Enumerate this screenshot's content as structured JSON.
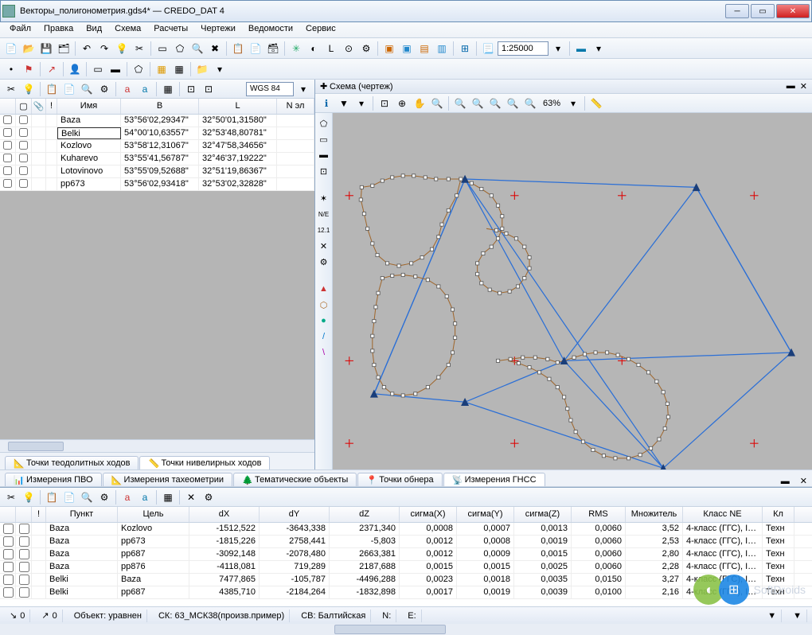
{
  "window": {
    "title": "Векторы_полигонометрия.gds4* — CREDO_DAT 4"
  },
  "menu": [
    "Файл",
    "Правка",
    "Вид",
    "Схема",
    "Расчеты",
    "Чертежи",
    "Ведомости",
    "Сервис"
  ],
  "scale": "1:25000",
  "coord_system": "WGS 84",
  "zoom_pct": "63%",
  "left_panel": {
    "headers": [
      "",
      "",
      "",
      "!",
      "Имя",
      "B",
      "L",
      "N эл"
    ],
    "rows": [
      {
        "name": "Baza",
        "b": "53°56'02,29347\"",
        "l": "32°50'01,31580\""
      },
      {
        "name": "Belki",
        "b": "54°00'10,63557\"",
        "l": "32°53'48,80781\""
      },
      {
        "name": "Kozlovo",
        "b": "53°58'12,31067\"",
        "l": "32°47'58,34656\""
      },
      {
        "name": "Kuharevo",
        "b": "53°55'41,56787\"",
        "l": "32°46'37,19222\""
      },
      {
        "name": "Lotovinovo",
        "b": "53°55'09,52688\"",
        "l": "32°51'19,86367\""
      },
      {
        "name": "pp673",
        "b": "53°56'02,93418\"",
        "l": "32°53'02,32828\""
      }
    ],
    "selected_row": 1
  },
  "left_tabs": [
    "Точки теодолитных ходов",
    "Точки нивелирных ходов"
  ],
  "left_tabs_active": 1,
  "mid_tabs": [
    "Измерения ПВО",
    "Измерения тахеометрии",
    "Тематические объекты",
    "Точки обнера",
    "Измерения ГНСС"
  ],
  "mid_tabs_active": 4,
  "scheme_title": "Схема (чертеж)",
  "bottom_grid": {
    "headers": [
      "",
      "",
      "!",
      "Пункт",
      "Цель",
      "dX",
      "dY",
      "dZ",
      "сигма(X)",
      "сигма(Y)",
      "сигма(Z)",
      "RMS",
      "Множитель",
      "Класс NE",
      "Кл"
    ],
    "widths": [
      20,
      20,
      18,
      90,
      90,
      88,
      88,
      88,
      72,
      72,
      72,
      68,
      72,
      100,
      40
    ],
    "rows": [
      {
        "p": "Baza",
        "t": "Kozlovo",
        "dx": "-1512,522",
        "dy": "-3643,338",
        "dz": "2371,340",
        "sx": "0,0008",
        "sy": "0,0007",
        "sz": "0,0013",
        "rms": "0,0060",
        "m": "3,52",
        "cls": "4-класс (ГГС), I…",
        "k": "Техн"
      },
      {
        "p": "Baza",
        "t": "pp673",
        "dx": "-1815,226",
        "dy": "2758,441",
        "dz": "-5,803",
        "sx": "0,0012",
        "sy": "0,0008",
        "sz": "0,0019",
        "rms": "0,0060",
        "m": "2,53",
        "cls": "4-класс (ГГС), I…",
        "k": "Техн"
      },
      {
        "p": "Baza",
        "t": "pp687",
        "dx": "-3092,148",
        "dy": "-2078,480",
        "dz": "2663,381",
        "sx": "0,0012",
        "sy": "0,0009",
        "sz": "0,0015",
        "rms": "0,0060",
        "m": "2,80",
        "cls": "4-класс (ГГС), I…",
        "k": "Техн"
      },
      {
        "p": "Baza",
        "t": "pp876",
        "dx": "-4118,081",
        "dy": "719,289",
        "dz": "2187,688",
        "sx": "0,0015",
        "sy": "0,0015",
        "sz": "0,0025",
        "rms": "0,0060",
        "m": "2,28",
        "cls": "4-класс (ГГС), I…",
        "k": "Техн"
      },
      {
        "p": "Belki",
        "t": "Baza",
        "dx": "7477,865",
        "dy": "-105,787",
        "dz": "-4496,288",
        "sx": "0,0023",
        "sy": "0,0018",
        "sz": "0,0035",
        "rms": "0,0150",
        "m": "3,27",
        "cls": "4-класс (ГГС), I…",
        "k": "Техн"
      },
      {
        "p": "Belki",
        "t": "pp687",
        "dx": "4385,710",
        "dy": "-2184,264",
        "dz": "-1832,898",
        "sx": "0,0017",
        "sy": "0,0019",
        "sz": "0,0039",
        "rms": "0,0100",
        "m": "2,16",
        "cls": "4-класс (ГГС), I…",
        "k": "Техн"
      }
    ]
  },
  "status": {
    "l1": "0",
    "l2": "0",
    "obj": "Объект:  уравнен",
    "ck": "СК:  63_МСК38(произв.пример)",
    "cb": "СВ:  Балтийская",
    "n": "N:",
    "e": "E:"
  },
  "watermark": "SoftDroids"
}
